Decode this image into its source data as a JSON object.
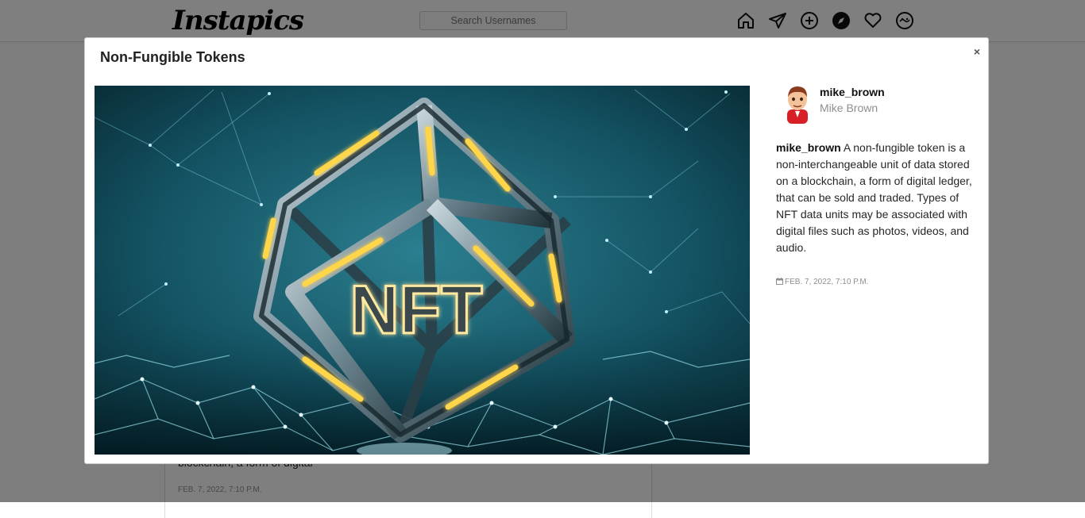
{
  "app": {
    "logo": "Instapics",
    "search_placeholder": "Search Usernames",
    "nav_icons": [
      "home-icon",
      "send-icon",
      "add-post-icon",
      "explore-icon",
      "heart-icon",
      "profile-icon"
    ]
  },
  "feed": {
    "caption_fragment": "blockchain, a form of digital",
    "date": "FEB. 7, 2022, 7:10 P.M."
  },
  "modal": {
    "title": "Non-Fungible Tokens",
    "close_label": "×",
    "image_text": "NFT",
    "author": {
      "username": "mike_brown",
      "full_name": "Mike Brown"
    },
    "caption_user": "mike_brown",
    "caption_text": " A non-fungible token is a non-interchangeable unit of data stored on a blockchain, a form of digital ledger, that can be sold and traded. Types of NFT data units may be associated with digital files such as photos, videos, and audio.",
    "date": "FEB. 7, 2022, 7:10 P.M."
  },
  "colors": {
    "overlay": "#000000",
    "image_bg_dark": "#0a2a33",
    "image_bg_light": "#1f6b7a",
    "glow": "#ffcc33"
  }
}
